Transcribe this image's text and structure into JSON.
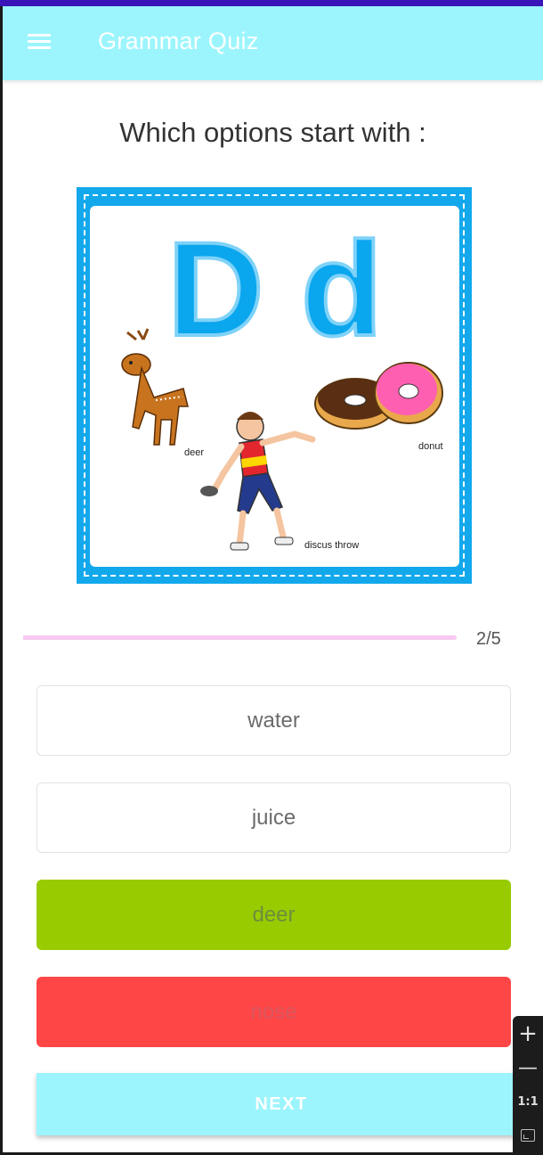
{
  "app_bar": {
    "title": "Grammar Quiz",
    "menu_icon": "hamburger-menu-icon"
  },
  "question": "Which options start with :",
  "card": {
    "letters": "D d",
    "labels": {
      "deer": "deer",
      "donut": "donut",
      "discus": "discus  throw"
    },
    "colors": {
      "frame": "#13a8ec",
      "letters": "#0aa6ee"
    }
  },
  "progress": {
    "text": "2/5",
    "current": 2,
    "total": 5
  },
  "options": [
    {
      "label": "water",
      "state": "neutral"
    },
    {
      "label": "juice",
      "state": "neutral"
    },
    {
      "label": "deer",
      "state": "correct",
      "color": "#98cc00"
    },
    {
      "label": "nose",
      "state": "wrong",
      "color": "#ff4646"
    }
  ],
  "next_button": {
    "label": "NEXT",
    "color": "#9cf5fd"
  },
  "zoom_controls": {
    "plus": "+",
    "minus": "—",
    "one_to_one": "1:1",
    "fit_icon": "fit-screen-icon"
  },
  "colors": {
    "app_bar": "#9cf5fd",
    "progress": "#f8c9f2"
  }
}
